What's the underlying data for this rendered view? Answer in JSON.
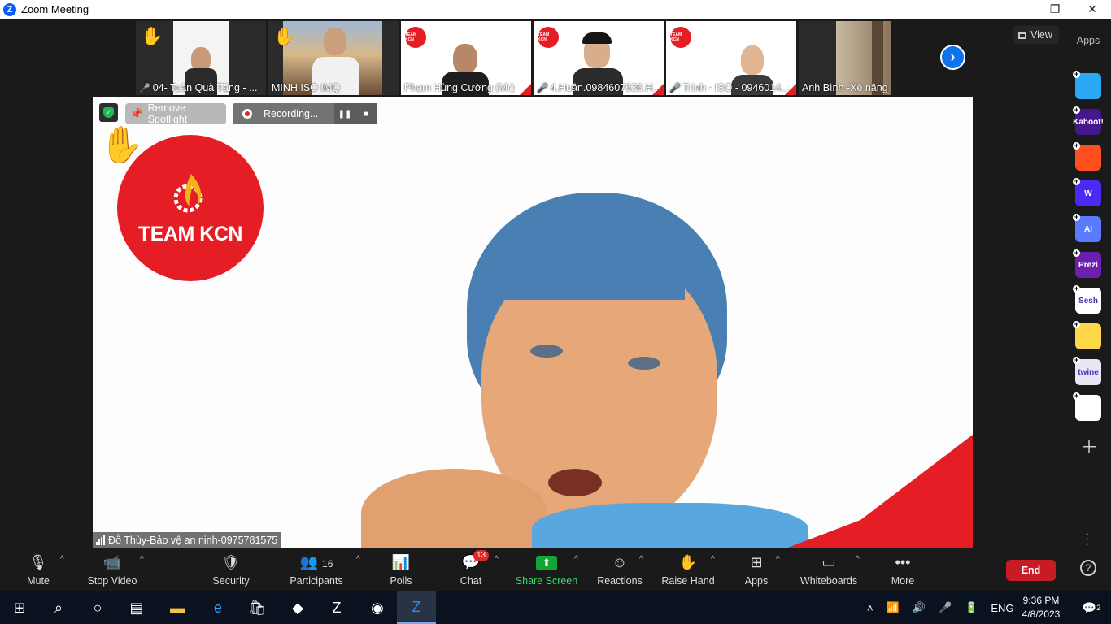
{
  "window": {
    "title": "Zoom Meeting",
    "minimize": "—",
    "maximize": "❐",
    "close": "✕"
  },
  "thumbnails": [
    {
      "name": "04- Toàn Quà Tặng - ...",
      "muted": true,
      "raised_hand": true
    },
    {
      "name": "MINH ISO IMQ",
      "muted": false,
      "raised_hand": true
    },
    {
      "name": "Phạm Hùng Cường (Mr)",
      "muted": false,
      "raised_hand": false
    },
    {
      "name": "4.Huân.0984607636.H...",
      "muted": true,
      "raised_hand": false
    },
    {
      "name": "Trinh - ISO - 0946014...",
      "muted": true,
      "raised_hand": false
    },
    {
      "name": "Anh Bình -Xe nâng",
      "muted": false,
      "raised_hand": false
    }
  ],
  "view_button": "View",
  "speaker": {
    "name": "Đỗ Thùy-Bảo vệ an ninh-0975781575",
    "remove_spotlight": "Remove Spotlight",
    "recording": "Recording...",
    "logo_text": "TEAM KCN"
  },
  "apps_panel": {
    "title": "Apps",
    "apps": [
      {
        "name": "Pointer",
        "label": "",
        "color": "#29a9f5"
      },
      {
        "name": "Kahoot",
        "label": "Kahoot!",
        "color": "#46178f"
      },
      {
        "name": "Confluent",
        "label": "",
        "color": "#ff4f1f"
      },
      {
        "name": "Wooclap",
        "label": "W",
        "color": "#4a2bf5"
      },
      {
        "name": "Ai",
        "label": "AI",
        "color": "#5a7bff"
      },
      {
        "name": "Prezi",
        "label": "Prezi",
        "color": "#6b1fb0"
      },
      {
        "name": "Sesh",
        "label": "Sesh",
        "color": "#ffffff"
      },
      {
        "name": "Emoji",
        "label": "",
        "color": "#ffd84a"
      },
      {
        "name": "Twine",
        "label": "twine",
        "color": "#e8e6f7"
      },
      {
        "name": "Grid",
        "label": "",
        "color": "#ffffff"
      }
    ]
  },
  "toolbar": {
    "mute": "Mute",
    "stop_video": "Stop Video",
    "security": "Security",
    "participants": "Participants",
    "participants_count": "16",
    "polls": "Polls",
    "chat": "Chat",
    "chat_badge": "13",
    "share_screen": "Share Screen",
    "reactions": "Reactions",
    "raise_hand": "Raise Hand",
    "apps": "Apps",
    "whiteboards": "Whiteboards",
    "more": "More",
    "end": "End"
  },
  "taskbar": {
    "language": "ENG",
    "time": "9:36 PM",
    "date": "4/8/2023",
    "notifications": "2"
  }
}
